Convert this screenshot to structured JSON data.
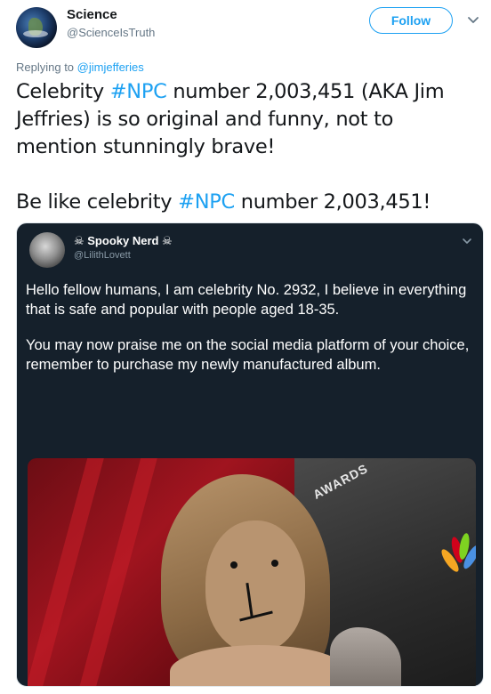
{
  "header": {
    "display_name": "Science",
    "handle": "@ScienceIsTruth",
    "follow_label": "Follow"
  },
  "reply": {
    "prefix": "Replying to",
    "mention": "@jimjefferies"
  },
  "tweet": {
    "line1_before": "Celebrity ",
    "line1_hashtag": "#NPC",
    "line1_after": " number 2,003,451 (AKA Jim Jeffries) is so original and funny, not to mention stunningly brave!",
    "line2_before": "Be like celebrity ",
    "line2_hashtag": "#NPC",
    "line2_after": " number 2,003,451!"
  },
  "embedded": {
    "name": "☠ Spooky Nerd ☠",
    "handle": "@LilithLovett",
    "para1": "Hello fellow humans, I am celebrity No. 2932, I believe in everything that is safe and popular with people aged 18-35.",
    "para2": "You may now praise me on the social media platform of your choice, remember to purchase my newly manufactured album.",
    "photo_backdrop_text": "AWARDS"
  },
  "icons": {
    "follow_menu": "chevron-down-icon",
    "embedded_menu": "chevron-down-icon"
  },
  "colors": {
    "accent": "#1da1f2",
    "text": "#14171a",
    "secondary": "#657786",
    "embedded_bg": "#15202b"
  }
}
